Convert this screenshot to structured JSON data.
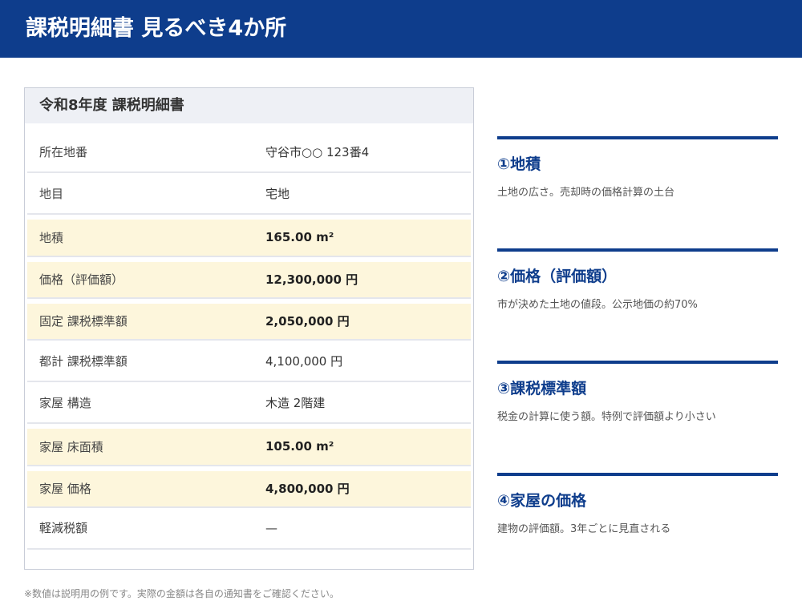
{
  "header": {
    "title": "課税明細書 見るべき4か所"
  },
  "card": {
    "title": "令和8年度 課税明細書",
    "rows": [
      {
        "label": "所在地番",
        "value": "守谷市○○ 123番4",
        "highlight": false
      },
      {
        "label": "地目",
        "value": "宅地",
        "highlight": false
      },
      {
        "label": "地積",
        "value": "165.00 m²",
        "highlight": true
      },
      {
        "label": "価格（評価額）",
        "value": "12,300,000 円",
        "highlight": true
      },
      {
        "label": "固定 課税標準額",
        "value": "2,050,000 円",
        "highlight": true
      },
      {
        "label": "都計 課税標準額",
        "value": "4,100,000 円",
        "highlight": false
      },
      {
        "label": "家屋 構造",
        "value": "木造 2階建",
        "highlight": false
      },
      {
        "label": "家屋 床面積",
        "value": "105.00 m²",
        "highlight": true
      },
      {
        "label": "家屋 価格",
        "value": "4,800,000 円",
        "highlight": true
      },
      {
        "label": "軽減税額",
        "value": "—",
        "highlight": false
      }
    ]
  },
  "points": [
    {
      "title": "①地積",
      "desc": "土地の広さ。売却時の価格計算の土台"
    },
    {
      "title": "②価格（評価額）",
      "desc": "市が決めた土地の値段。公示地価の約70%"
    },
    {
      "title": "③課税標準額",
      "desc": "税金の計算に使う額。特例で評価額より小さい"
    },
    {
      "title": "④家屋の価格",
      "desc": "建物の評価額。3年ごとに見直される"
    }
  ],
  "note": "※数値は説明用の例です。実際の金額は各自の通知書をご確認ください。",
  "colors": {
    "accent": "#0e3d8c",
    "highlight_row": "#fdf6dc"
  }
}
